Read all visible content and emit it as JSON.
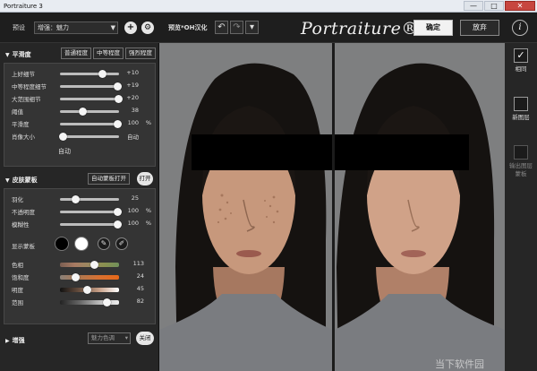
{
  "window": {
    "title": "Portraiture 3",
    "buttons": {
      "minimize": "—",
      "maximize": "□",
      "close": "✕"
    }
  },
  "toolbar": {
    "preset_label": "预设",
    "preset_value": "增强：魅力",
    "add_label": "+",
    "preview_label": "预览",
    "preview_sub": "*OH汉化",
    "undo_label": "↶",
    "redo_label": "↷",
    "history_dropdown": "▾",
    "logo": "Portraiture® 3",
    "ok_label": "确定",
    "cancel_label": "放弃",
    "info_label": "i"
  },
  "smoothing": {
    "title": "平滑度",
    "presets": [
      "普通程度",
      "中等程度",
      "强烈程度"
    ],
    "sliders": [
      {
        "name": "上好细节",
        "value": "+10",
        "unit": "",
        "fraction": 0.72
      },
      {
        "name": "中等程度细节",
        "value": "+19",
        "unit": "",
        "fraction": 0.97
      },
      {
        "name": "大范围细节",
        "value": "+20",
        "unit": "",
        "fraction": 0.99
      },
      {
        "name": "阈值",
        "value": "38",
        "unit": "",
        "fraction": 0.38
      },
      {
        "name": "平滑度",
        "value": "100",
        "unit": "%",
        "fraction": 0.97
      },
      {
        "name": "肖像大小",
        "value": "自动",
        "unit": "",
        "fraction": 0.05
      }
    ],
    "auto_label": "自动"
  },
  "skin_mask": {
    "title": "皮肤蒙板",
    "auto_mask_label": "自动蒙板打开",
    "toggle_label": "打开",
    "sliders": [
      {
        "name": "羽化",
        "value": "25",
        "unit": "",
        "fraction": 0.27
      },
      {
        "name": "不透明度",
        "value": "100",
        "unit": "%",
        "fraction": 0.97
      },
      {
        "name": "模糊性",
        "value": "100",
        "unit": "%",
        "fraction": 0.97
      }
    ],
    "show_mask_label": "显示蒙板",
    "colors": [
      {
        "name": "色相",
        "value": "113",
        "fraction": 0.58
      },
      {
        "name": "饱和度",
        "value": "24",
        "fraction": 0.26
      },
      {
        "name": "明度",
        "value": "45",
        "fraction": 0.46
      },
      {
        "name": "范围",
        "value": "82",
        "fraction": 0.8
      }
    ]
  },
  "enhance": {
    "title": "增强",
    "mode_value": "魅力色调",
    "close_label": "关闭"
  },
  "right_panel": {
    "same_label": "相同",
    "new_layer_label": "新图层",
    "output_mask_label": "输出图层蒙板"
  },
  "watermark": "当下软件园"
}
